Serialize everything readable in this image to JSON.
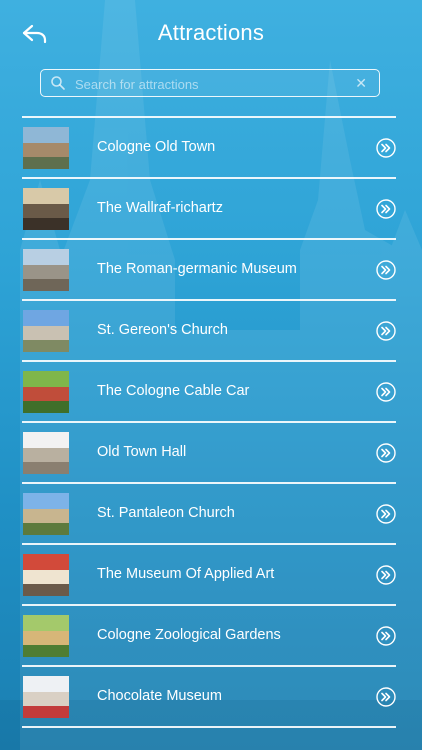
{
  "header": {
    "title": "Attractions",
    "back_icon": "back-arrow-icon"
  },
  "search": {
    "placeholder": "Search for attractions",
    "value": "",
    "icon": "search-icon",
    "clear_icon": "clear-icon",
    "clear_glyph": "✕"
  },
  "colors": {
    "background_top": "#3fb0e0",
    "background_bottom": "#1b7fb1",
    "text": "#ffffff"
  },
  "attractions": [
    {
      "name": "Cologne Old Town",
      "thumb_colors": [
        "#8fb7d6",
        "#a68a6a",
        "#5e6f4d"
      ]
    },
    {
      "name": "The Wallraf-richartz",
      "thumb_colors": [
        "#d8c9a8",
        "#6a5a48",
        "#3b3128"
      ]
    },
    {
      "name": "The Roman-germanic Museum",
      "thumb_colors": [
        "#b8cfe3",
        "#9a9488",
        "#6f6658"
      ]
    },
    {
      "name": "St. Gereon's Church",
      "thumb_colors": [
        "#6fa6e2",
        "#c9c1b2",
        "#7f8a63"
      ]
    },
    {
      "name": "The Cologne Cable Car",
      "thumb_colors": [
        "#7fb64a",
        "#c04d3a",
        "#3f6f2a"
      ]
    },
    {
      "name": "Old Town Hall",
      "thumb_colors": [
        "#f2f2f2",
        "#b9b0a0",
        "#8a7f70"
      ]
    },
    {
      "name": "St. Pantaleon Church",
      "thumb_colors": [
        "#7db3e8",
        "#c8b58f",
        "#5d7a3d"
      ]
    },
    {
      "name": "The Museum Of Applied Art",
      "thumb_colors": [
        "#d24a3a",
        "#efe4d0",
        "#6b5a4a"
      ]
    },
    {
      "name": "Cologne Zoological Gardens",
      "thumb_colors": [
        "#a4c96b",
        "#d7b678",
        "#4f7d33"
      ]
    },
    {
      "name": "Chocolate Museum",
      "thumb_colors": [
        "#eef1f4",
        "#d9d0c4",
        "#c23b3b"
      ]
    }
  ],
  "row_action_icon": "chevron-right-circle-icon"
}
